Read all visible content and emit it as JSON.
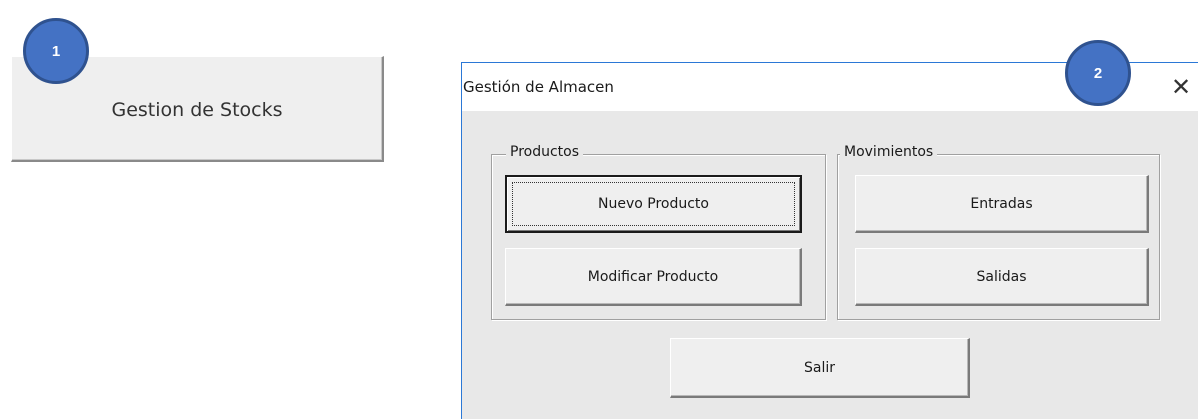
{
  "callouts": {
    "first": "1",
    "second": "2"
  },
  "launcher_button": {
    "label": "Gestion de Stocks"
  },
  "dialog": {
    "title": "Gestión de Almacen",
    "close_glyph": "✕",
    "groups": {
      "productos": {
        "legend": "Productos",
        "buttons": {
          "nuevo": "Nuevo Producto",
          "modificar": "Modificar Producto"
        }
      },
      "movimientos": {
        "legend": "Movimientos",
        "buttons": {
          "entradas": "Entradas",
          "salidas": "Salidas"
        }
      }
    },
    "exit_button": "Salir"
  },
  "colors": {
    "callout_fill": "#4472c4",
    "callout_border": "#2f528f",
    "window_border": "#2b78d6",
    "dialog_bg": "#e8e8e8"
  }
}
